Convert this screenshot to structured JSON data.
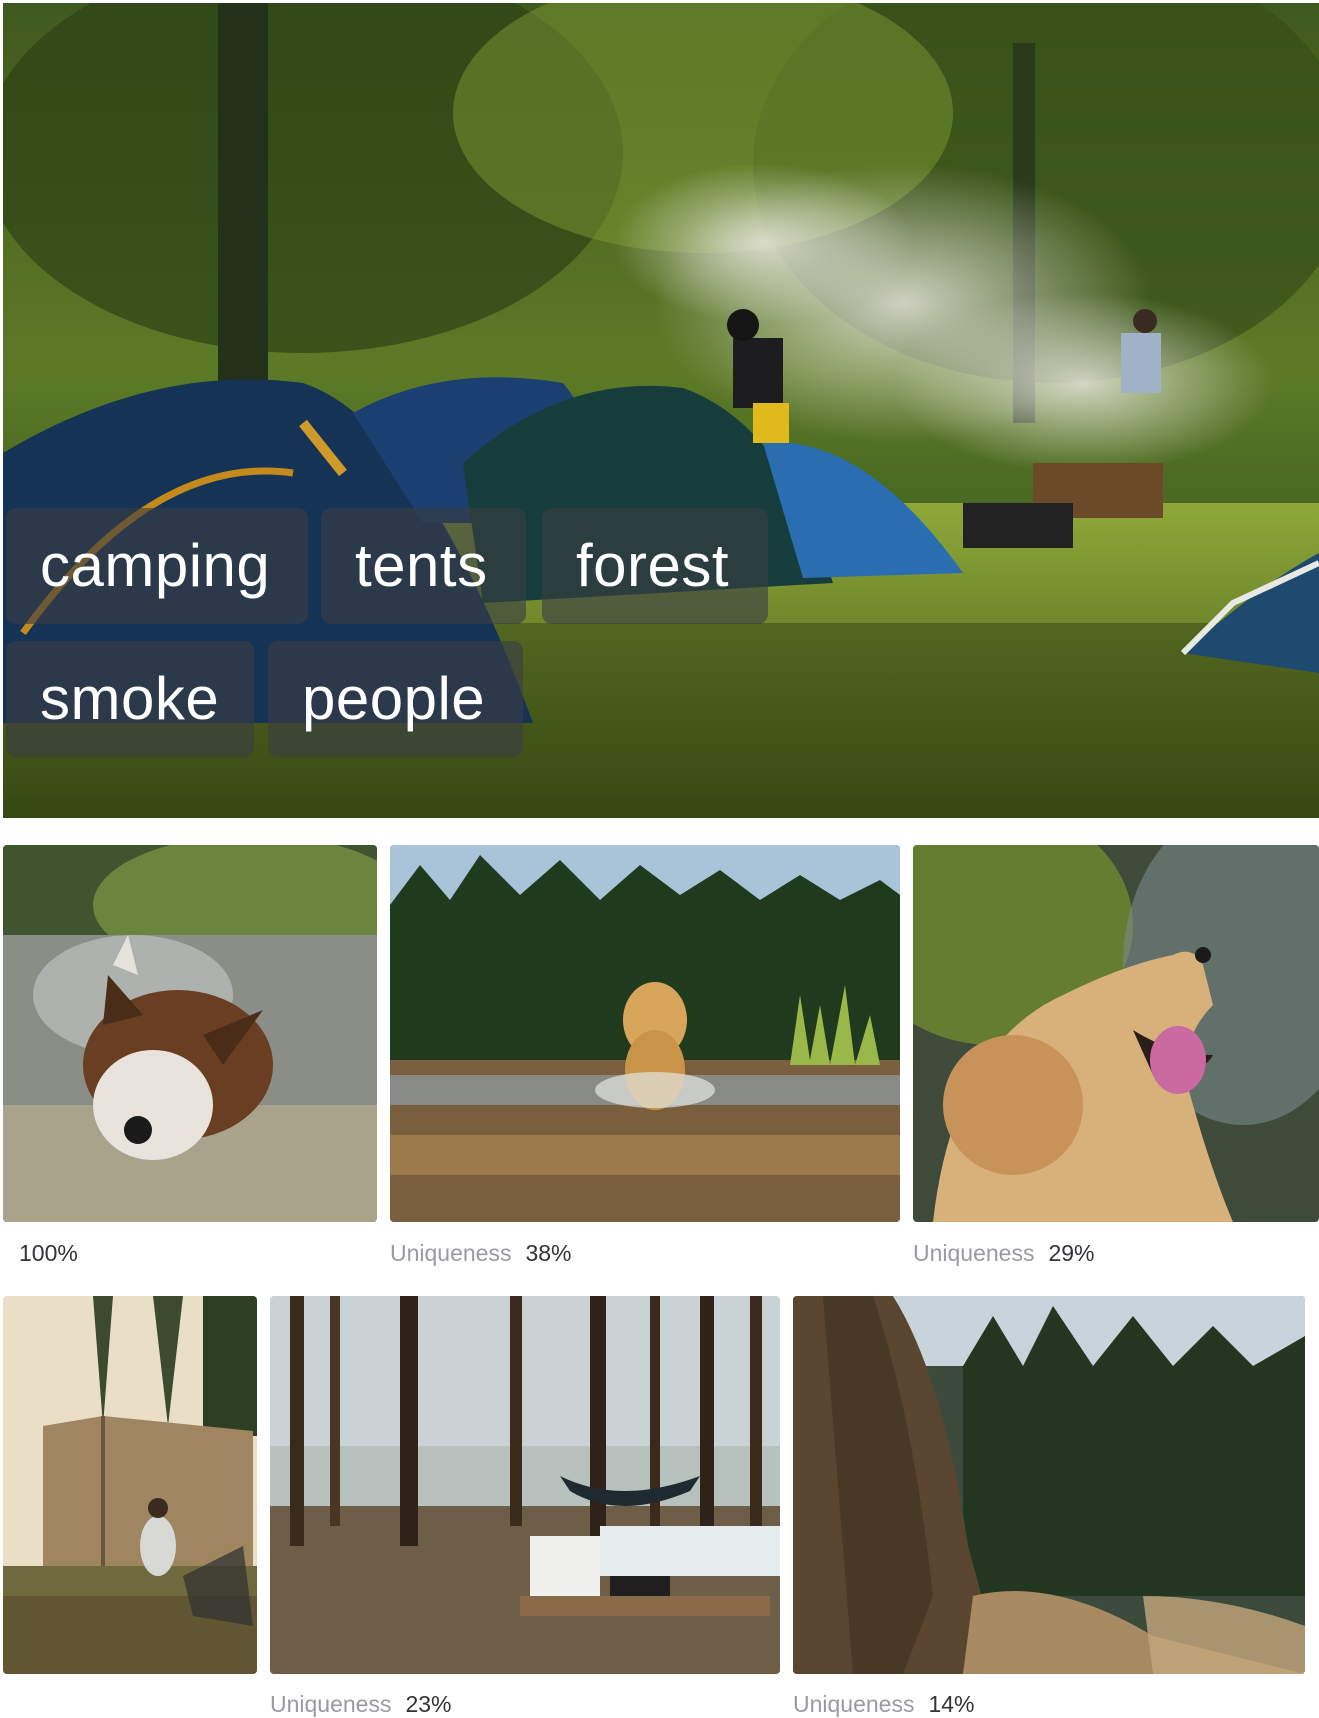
{
  "hero": {
    "image": "campsite-tents-forest-smoke",
    "tags": [
      "camping",
      "tents",
      "forest",
      "smoke",
      "people"
    ]
  },
  "gallery": {
    "row1": [
      {
        "image": "dog-shaking-water-river",
        "label": "",
        "value": "100%"
      },
      {
        "image": "golden-retriever-in-lake",
        "label": "Uniqueness",
        "value": "38%"
      },
      {
        "image": "golden-retriever-catching-water",
        "label": "Uniqueness",
        "value": "29%"
      }
    ],
    "row2": [
      {
        "image": "woman-by-canvas-tent"
      },
      {
        "image": "hammock-camp-forest-lake",
        "label": "Uniqueness",
        "value": "23%"
      },
      {
        "image": "rock-wall-trail-pines",
        "label": "Uniqueness",
        "value": "14%"
      }
    ]
  },
  "colors": {
    "tag_bg": "#3a3e44",
    "label": "#9a9aa0",
    "value": "#333338"
  }
}
